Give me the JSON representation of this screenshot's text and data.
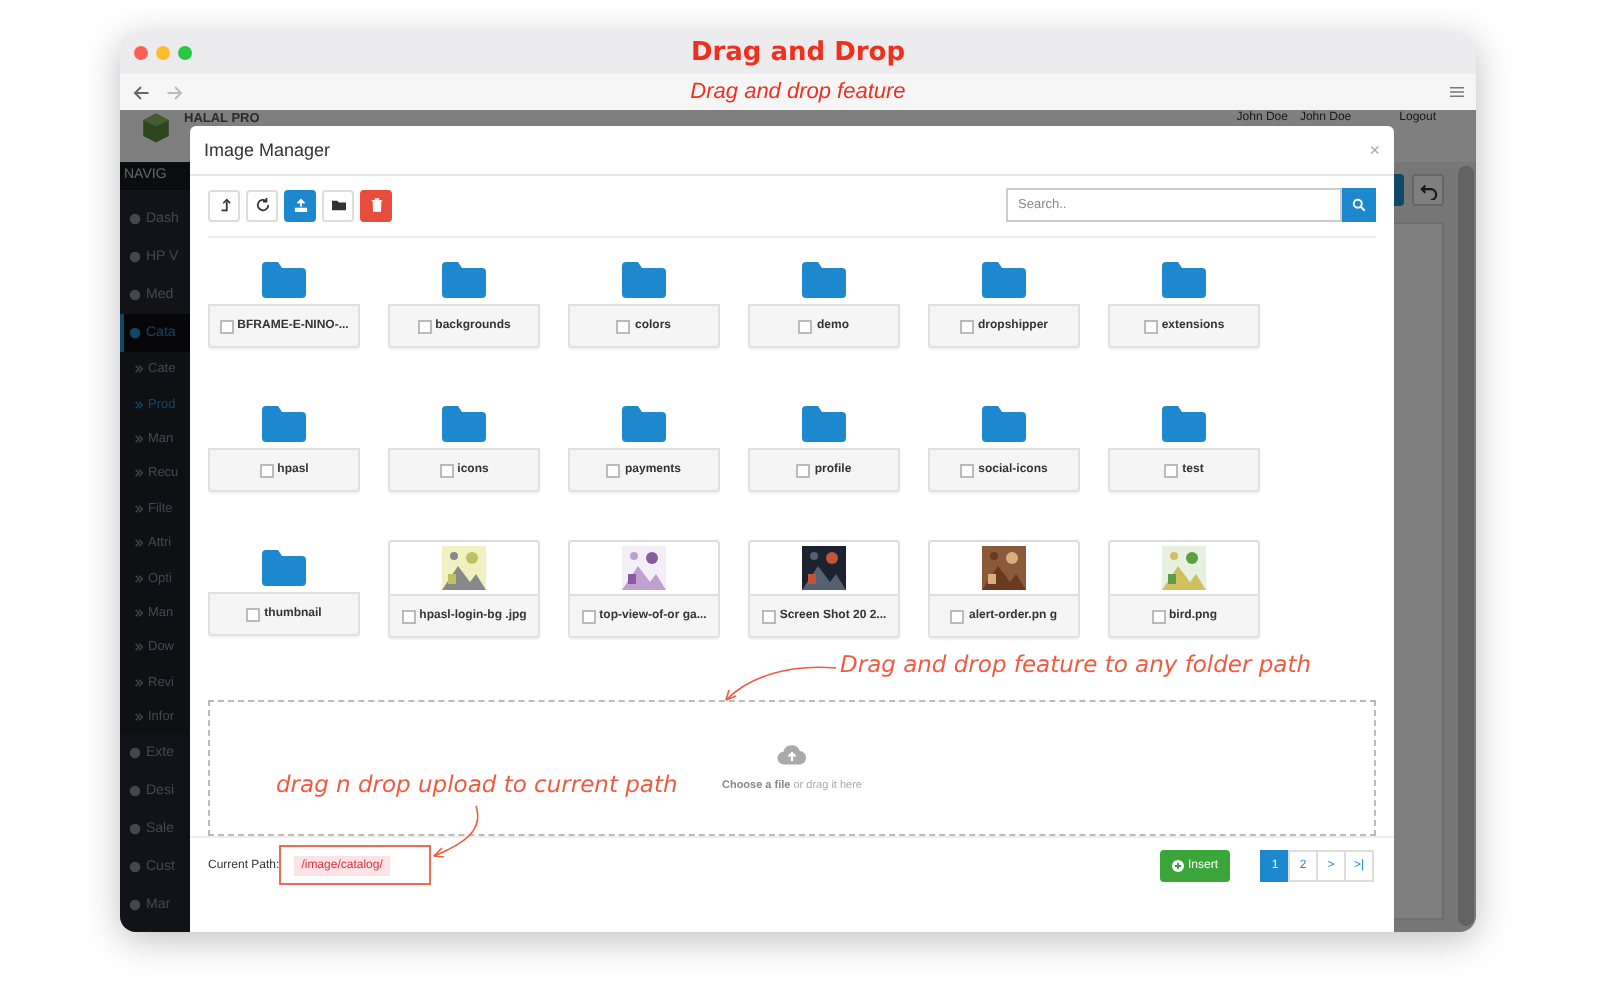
{
  "browser": {
    "title": "Drag and Drop",
    "subtitle": "Drag and drop feature"
  },
  "app": {
    "logo": "HALAL PRO",
    "user_short": "John Doe",
    "user": "John Doe",
    "logout": "Logout",
    "nav_title": "NAVIG",
    "sidebar": [
      {
        "label": "Dash",
        "selected": false
      },
      {
        "label": "HP V",
        "selected": false
      },
      {
        "label": "Med",
        "selected": false
      },
      {
        "label": "Cata",
        "selected": true,
        "expanded": true,
        "children": [
          {
            "label": "Cate",
            "selected": false
          },
          {
            "label": "Prod",
            "selected": true
          },
          {
            "label": "Man",
            "selected": false
          },
          {
            "label": "Recu",
            "selected": false
          },
          {
            "label": "Filte",
            "selected": false
          },
          {
            "label": "Attri",
            "selected": false
          },
          {
            "label": "Opti",
            "selected": false
          },
          {
            "label": "Man",
            "selected": false
          },
          {
            "label": "Dow",
            "selected": false
          },
          {
            "label": "Revi",
            "selected": false
          },
          {
            "label": "Infor",
            "selected": false
          }
        ]
      },
      {
        "label": "Exte",
        "selected": false
      },
      {
        "label": "Desi",
        "selected": false
      },
      {
        "label": "Sale",
        "selected": false
      },
      {
        "label": "Cust",
        "selected": false
      },
      {
        "label": "Mar",
        "selected": false
      }
    ]
  },
  "modal": {
    "title": "Image Manager",
    "close": "×",
    "search": {
      "placeholder": "Search.."
    },
    "items": [
      {
        "kind": "folder",
        "name": "BFRAME-E-NINO-...",
        "checked": false
      },
      {
        "kind": "folder",
        "name": "backgrounds",
        "checked": false
      },
      {
        "kind": "folder",
        "name": "colors",
        "checked": false
      },
      {
        "kind": "folder",
        "name": "demo",
        "checked": false
      },
      {
        "kind": "folder",
        "name": "dropshipper",
        "checked": false
      },
      {
        "kind": "folder",
        "name": "extensions",
        "checked": false
      },
      {
        "kind": "folder",
        "name": "hpasl",
        "checked": false
      },
      {
        "kind": "folder",
        "name": "icons",
        "checked": false
      },
      {
        "kind": "folder",
        "name": "payments",
        "checked": false
      },
      {
        "kind": "folder",
        "name": "profile",
        "checked": false
      },
      {
        "kind": "folder",
        "name": "social-icons",
        "checked": false
      },
      {
        "kind": "folder",
        "name": "test",
        "checked": false
      },
      {
        "kind": "folder",
        "name": "thumbnail",
        "checked": false
      },
      {
        "name": "hpasl-login-bg .jpg",
        "checked": false
      },
      {
        "name": "top-view-of-or ga...",
        "checked": false
      },
      {
        "name": "Screen Shot 20 2...",
        "checked": false
      },
      {
        "name": "alert-order.pn g",
        "checked": false
      },
      {
        "name": "bird.png",
        "checked": false
      }
    ],
    "dropzone": "**Choose a file** or drag it here",
    "path_label": "Current Path:",
    "path": "/image/catalog/",
    "insert": "Insert",
    "pages": [
      {
        "label": "1",
        "selected": true
      },
      {
        "label": "2",
        "selected": false
      },
      {
        "label": ">",
        "selected": false
      },
      {
        "label": ">|",
        "selected": false
      }
    ]
  },
  "annotations": [
    {
      "text": "Drag and drop feature to any folder path"
    },
    {
      "text": "drag n drop upload to current path"
    }
  ]
}
